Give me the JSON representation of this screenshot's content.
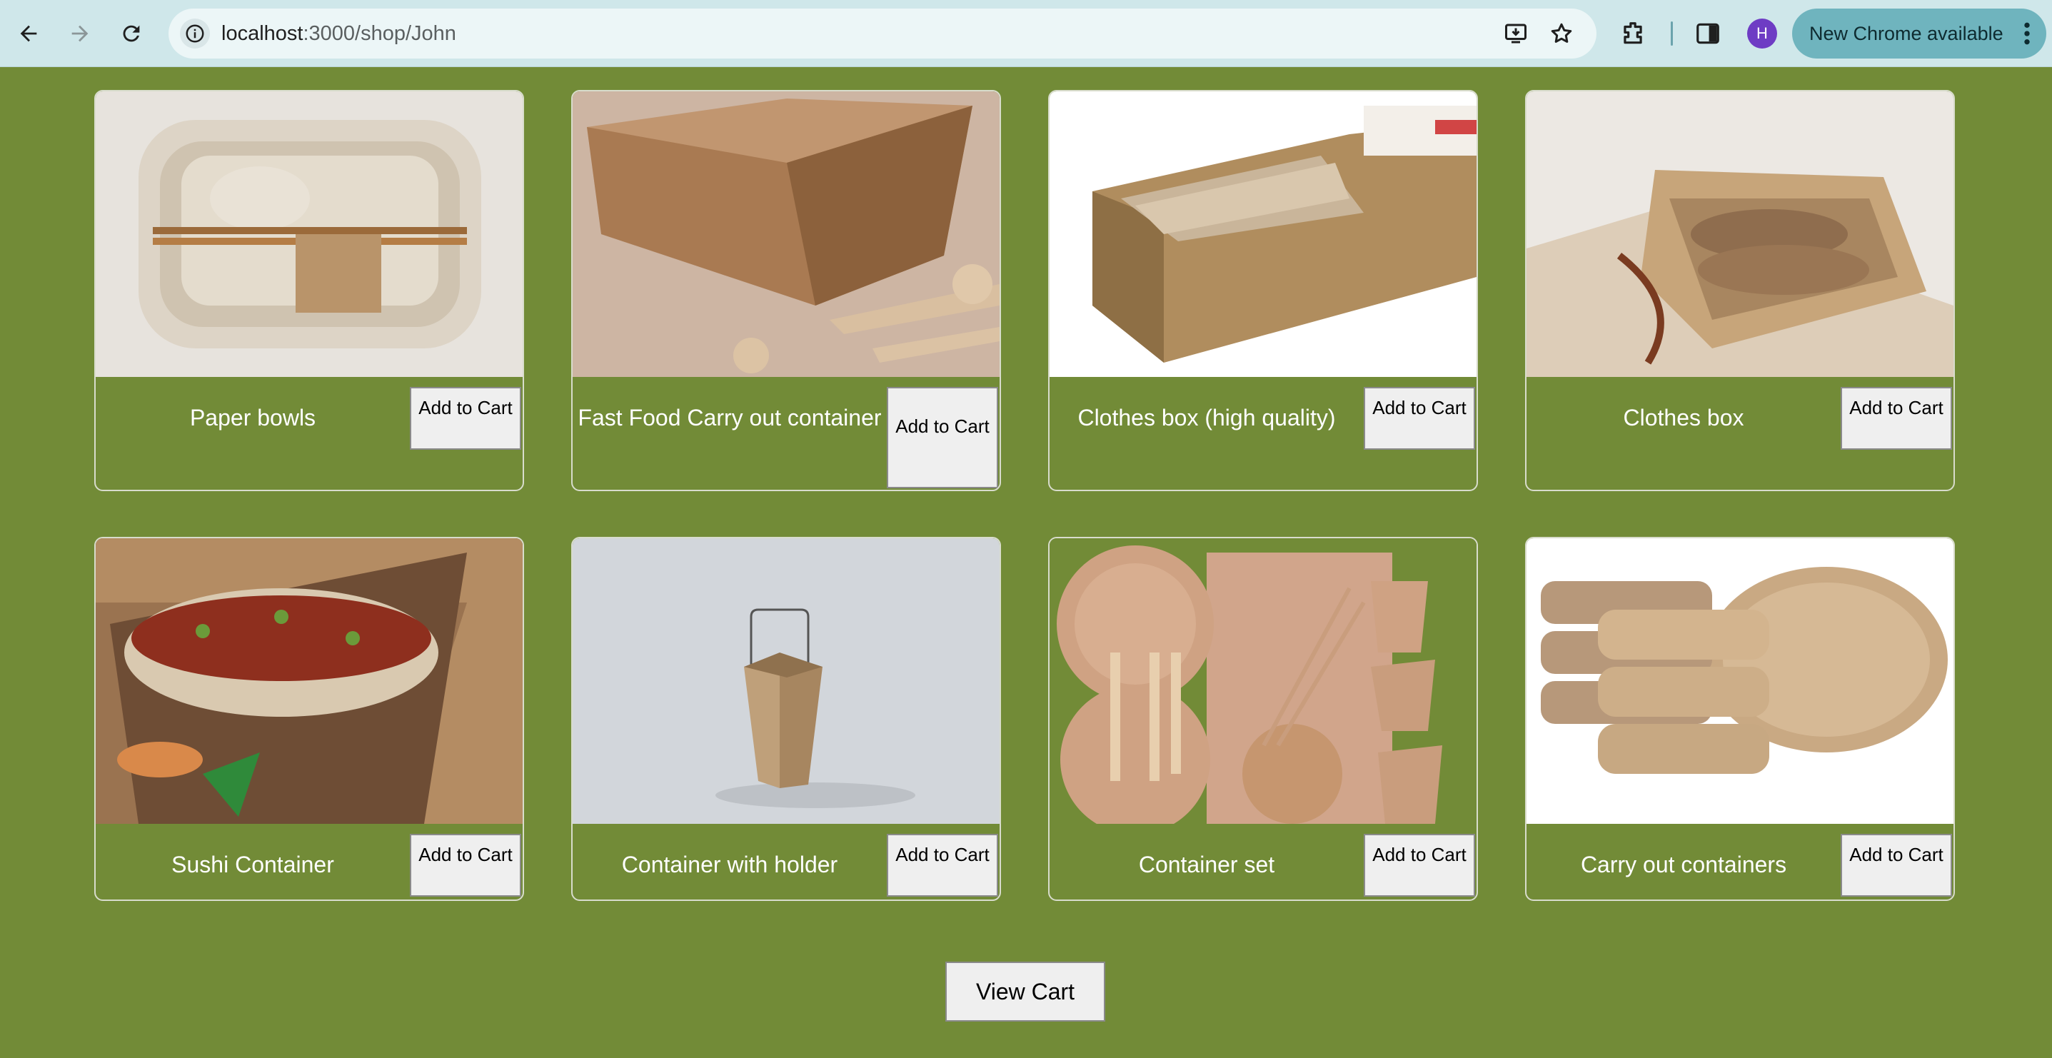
{
  "browser": {
    "url_host": "localhost",
    "url_path": ":3000/shop/John",
    "profile_initial": "H",
    "update_label": "New Chrome available"
  },
  "products": [
    {
      "name": "Paper bowls",
      "button": "Add to Cart"
    },
    {
      "name": "Fast Food Carry out container",
      "button": "Add to Cart"
    },
    {
      "name": "Clothes box (high quality)",
      "button": "Add to Cart"
    },
    {
      "name": "Clothes box",
      "button": "Add to Cart"
    },
    {
      "name": "Sushi Container",
      "button": "Add to Cart"
    },
    {
      "name": "Container with holder",
      "button": "Add to Cart"
    },
    {
      "name": "Container set",
      "button": "Add to Cart"
    },
    {
      "name": "Carry out containers",
      "button": "Add to Cart"
    }
  ],
  "cart": {
    "view_label": "View Cart"
  },
  "colors": {
    "page_background": "#728b37",
    "browser_toolbar": "#cfe7ea",
    "button_background": "#efefef"
  }
}
